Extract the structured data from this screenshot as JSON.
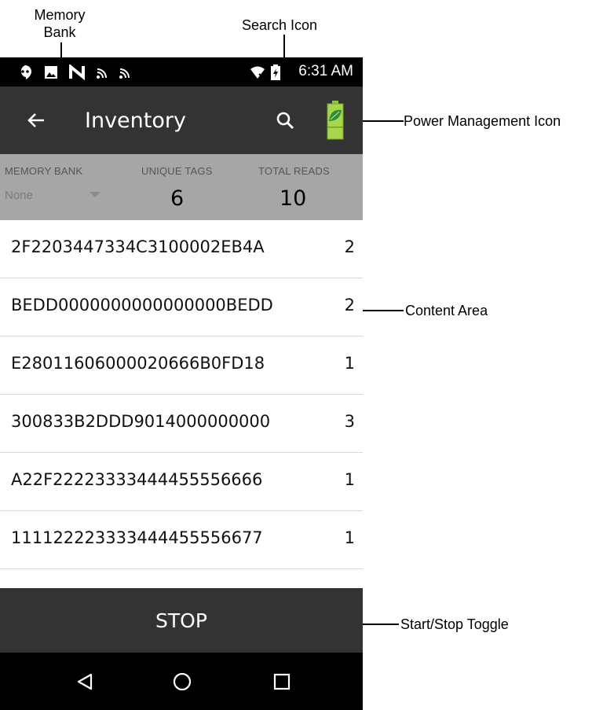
{
  "callouts": {
    "memory_bank": [
      "Memory",
      "Bank"
    ],
    "search_icon": "Search Icon",
    "power_management_icon": "Power Management Icon",
    "content_area": "Content Area",
    "start_stop_toggle": "Start/Stop Toggle"
  },
  "status_bar": {
    "time": "6:31 AM",
    "icons": [
      "hangouts-icon",
      "image-icon",
      "nfc-icon",
      "rfid-icon",
      "rfid-icon",
      "wifi-off-icon",
      "battery-charging-icon"
    ]
  },
  "app_bar": {
    "title": "Inventory",
    "icons": [
      "back-arrow-icon",
      "search-icon",
      "battery-leaf-icon"
    ]
  },
  "header": {
    "memory_bank_label": "MEMORY BANK",
    "memory_bank_value": "None",
    "unique_tags_label": "UNIQUE TAGS",
    "unique_tags_value": "6",
    "total_reads_label": "TOTAL READS",
    "total_reads_value": "10"
  },
  "tags": [
    {
      "id": "2F2203447334C3100002EB4A",
      "count": "2"
    },
    {
      "id": "BEDD0000000000000000BEDD",
      "count": "2"
    },
    {
      "id": "E28011606000020666B0FD18",
      "count": "1"
    },
    {
      "id": "300833B2DDD9014000000000",
      "count": "3"
    },
    {
      "id": "A22F22223333444455556666",
      "count": "1"
    },
    {
      "id": "111122223333444455556677",
      "count": "1"
    }
  ],
  "stop_label": "STOP",
  "nav_bar": {
    "icons": [
      "back-triangle-icon",
      "home-circle-icon",
      "recents-square-icon"
    ]
  },
  "colors": {
    "app_bar": "#333333",
    "header_bg": "#a6a6a6",
    "battery_green": "#8cc63f"
  }
}
